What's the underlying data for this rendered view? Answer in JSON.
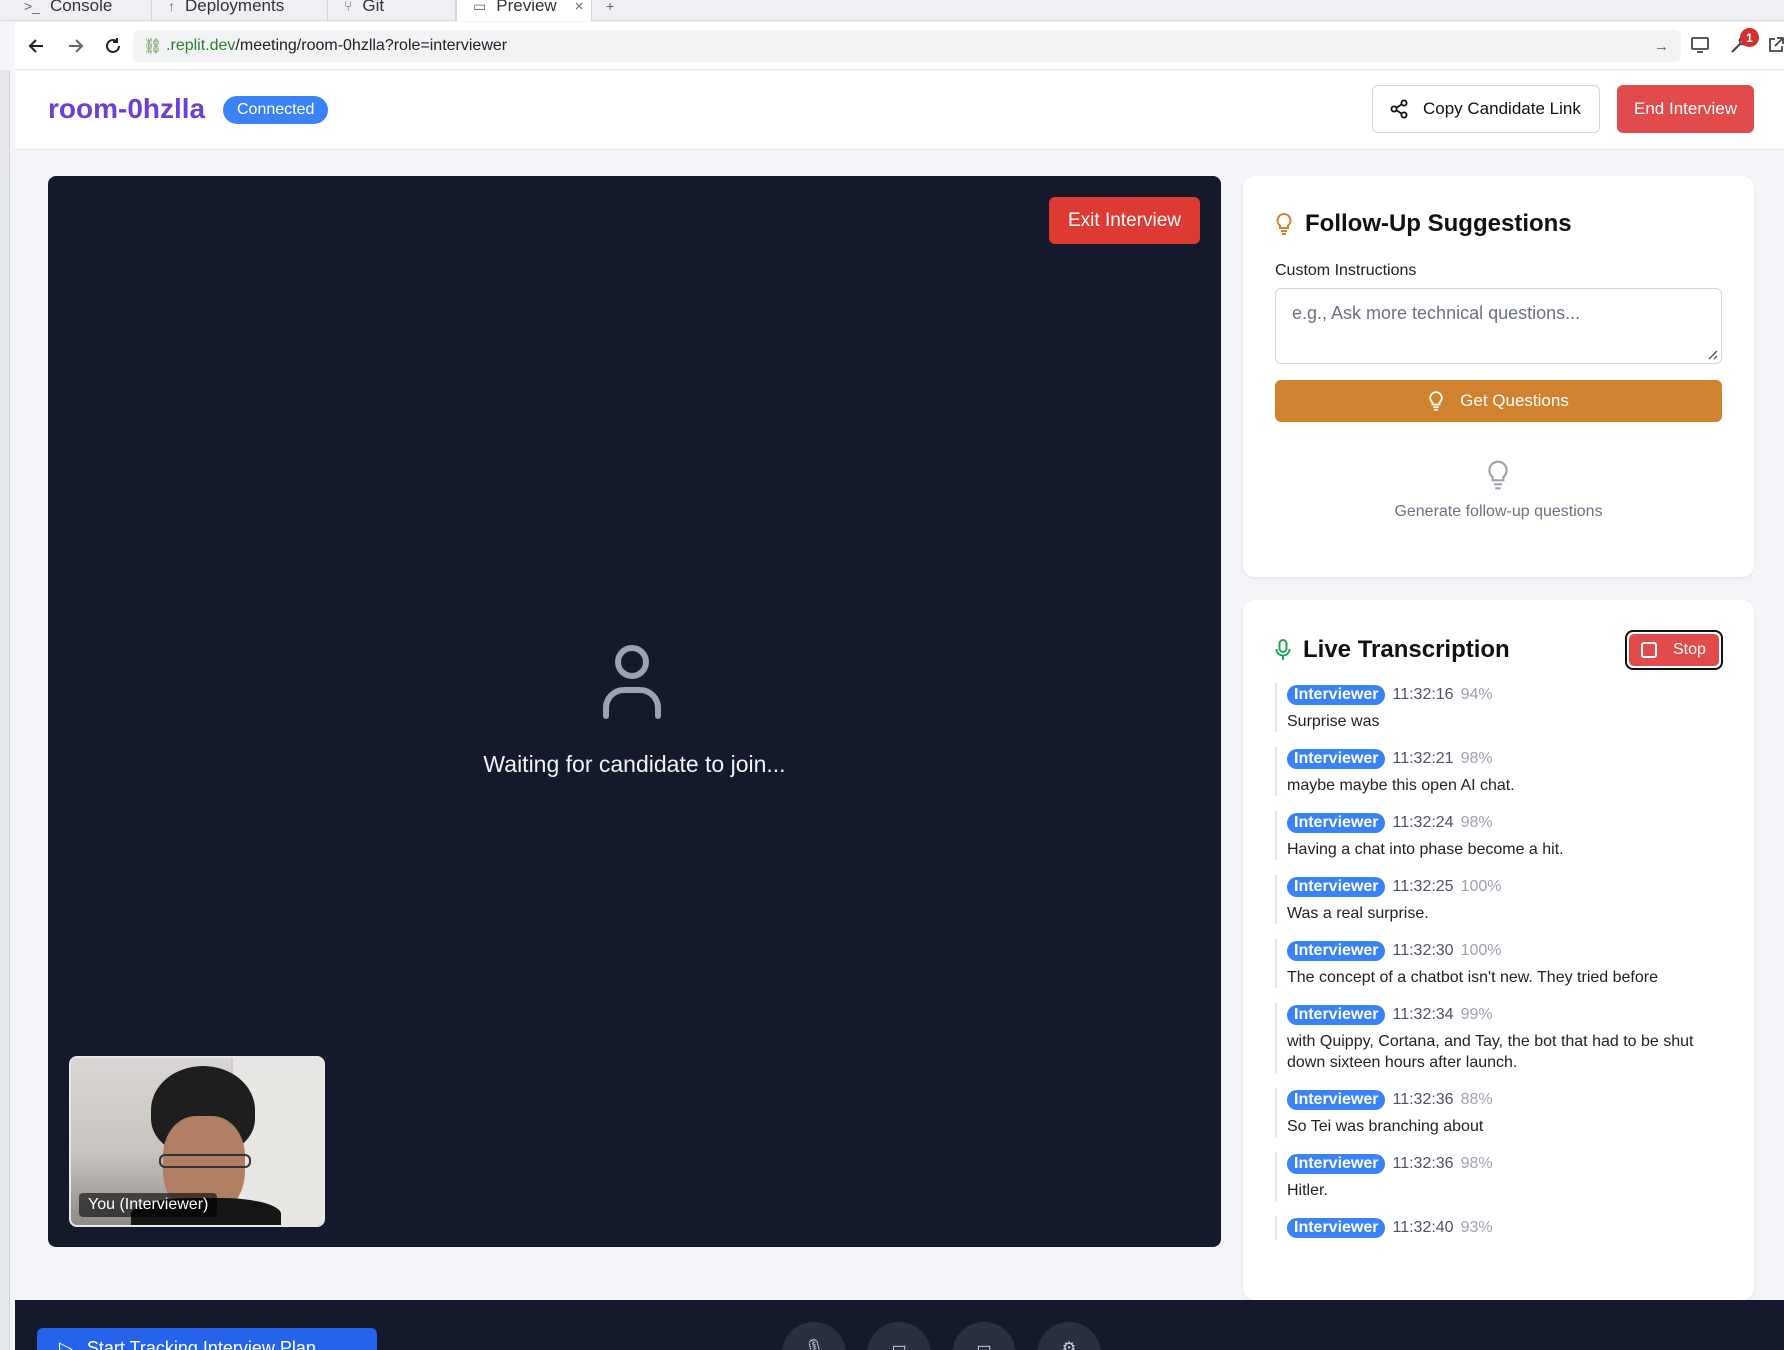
{
  "browser": {
    "tabs": [
      {
        "label": "Console",
        "icon": "console-icon"
      },
      {
        "label": "Deployments",
        "icon": "deploy-icon"
      },
      {
        "label": "Git",
        "icon": "git-icon"
      },
      {
        "label": "Preview",
        "icon": "monitor-icon",
        "active": true
      }
    ],
    "url_domain": ".replit.dev",
    "url_path": "/meeting/room-0hzlla?role=interviewer",
    "notification_count": "1"
  },
  "header": {
    "room_name": "room-0hzlla",
    "status": "Connected",
    "copy_link_label": "Copy Candidate Link",
    "end_label": "End Interview"
  },
  "video": {
    "exit_label": "Exit Interview",
    "waiting_text": "Waiting for candidate to join...",
    "self_label": "You (Interviewer)"
  },
  "followup": {
    "title": "Follow-Up Suggestions",
    "custom_label": "Custom Instructions",
    "placeholder": "e.g., Ask more technical questions...",
    "button_label": "Get Questions",
    "empty_text": "Generate follow-up questions"
  },
  "transcription": {
    "title": "Live Transcription",
    "stop_label": "Stop",
    "entries": [
      {
        "speaker": "Interviewer",
        "time": "11:32:16",
        "confidence": "94%",
        "text": "Surprise was"
      },
      {
        "speaker": "Interviewer",
        "time": "11:32:21",
        "confidence": "98%",
        "text": "maybe maybe this open AI chat."
      },
      {
        "speaker": "Interviewer",
        "time": "11:32:24",
        "confidence": "98%",
        "text": "Having a chat into phase become a hit."
      },
      {
        "speaker": "Interviewer",
        "time": "11:32:25",
        "confidence": "100%",
        "text": "Was a real surprise."
      },
      {
        "speaker": "Interviewer",
        "time": "11:32:30",
        "confidence": "100%",
        "text": "The concept of a chatbot isn't new. They tried before"
      },
      {
        "speaker": "Interviewer",
        "time": "11:32:34",
        "confidence": "99%",
        "text": "with Quippy, Cortana, and Tay, the bot that had to be shut down sixteen hours after launch."
      },
      {
        "speaker": "Interviewer",
        "time": "11:32:36",
        "confidence": "88%",
        "text": "So Tei was branching about"
      },
      {
        "speaker": "Interviewer",
        "time": "11:32:36",
        "confidence": "98%",
        "text": "Hitler."
      },
      {
        "speaker": "Interviewer",
        "time": "11:32:40",
        "confidence": "93%",
        "text": ""
      }
    ]
  },
  "bottom": {
    "start_label": "Start Tracking Interview Plan"
  },
  "colors": {
    "brand_purple": "#6d3fd6",
    "status_blue": "#3b82f6",
    "danger_red": "#e24b4b",
    "accent_orange": "#d0822e",
    "video_bg": "#141a2c"
  }
}
